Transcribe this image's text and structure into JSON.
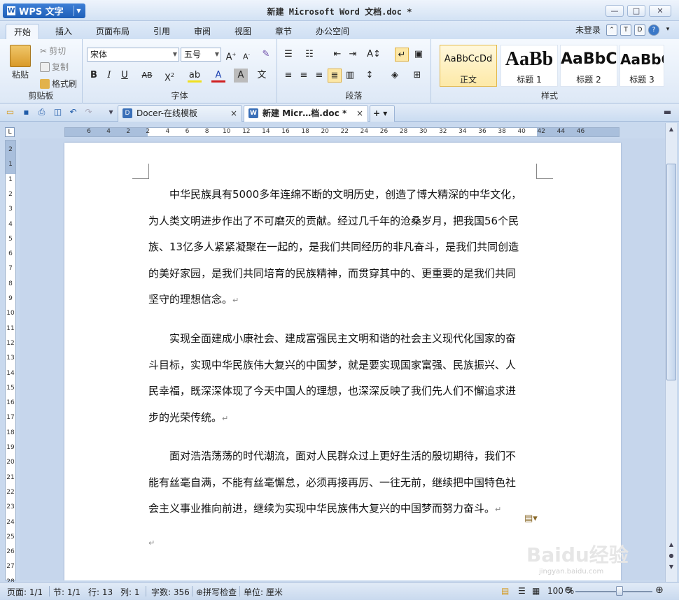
{
  "app": {
    "name": "WPS 文字",
    "title": "新建 Microsoft Word 文档.doc *"
  },
  "window_controls": {
    "minimize": "—",
    "maximize": "□",
    "close": "✕"
  },
  "menu": {
    "tabs": [
      "开始",
      "插入",
      "页面布局",
      "引用",
      "审阅",
      "视图",
      "章节",
      "办公空间"
    ],
    "login": "未登录"
  },
  "ribbon": {
    "clipboard": {
      "paste": "粘贴",
      "cut": "剪切",
      "copy": "复制",
      "format_painter": "格式刷",
      "label": "剪贴板"
    },
    "font": {
      "font_name": "宋体",
      "font_size": "五号",
      "label": "字体"
    },
    "paragraph": {
      "label": "段落"
    },
    "styles": {
      "label": "样式",
      "items": [
        {
          "sample": "AaBbCcDd",
          "name": "正文"
        },
        {
          "sample": "AaBb",
          "name": "标题 1"
        },
        {
          "sample": "AaBbC",
          "name": "标题 2"
        },
        {
          "sample": "AaBbC",
          "name": "标题 3"
        }
      ]
    }
  },
  "doc_tabs": [
    {
      "label": "Docer-在线模板",
      "active": false
    },
    {
      "label": "新建 Micr…档.doc *",
      "active": true
    }
  ],
  "ruler": {
    "horizontal": [
      "6",
      "4",
      "2",
      "2",
      "4",
      "6",
      "8",
      "10",
      "12",
      "14",
      "16",
      "18",
      "20",
      "22",
      "24",
      "26",
      "28",
      "30",
      "32",
      "34",
      "36",
      "38",
      "40",
      "42",
      "44",
      "46"
    ],
    "vertical": [
      "2",
      "1",
      "1",
      "2",
      "3",
      "4",
      "5",
      "6",
      "7",
      "8",
      "9",
      "10",
      "11",
      "12",
      "13",
      "14",
      "15",
      "16",
      "17",
      "18",
      "19",
      "20",
      "21",
      "22",
      "23",
      "24",
      "25",
      "26",
      "27",
      "28"
    ]
  },
  "document": {
    "paragraphs": [
      [
        "中华民族具有5000多年连绵不断的文明历史，创造了博大精深的中华文化，",
        "为人类文明进步作出了不可磨灭的贡献。经过几千年的沧桑岁月，把我国56个民",
        "族、13亿多人紧紧凝聚在一起的，是我们共同经历的非凡奋斗，是我们共同创造",
        "的美好家园，是我们共同培育的民族精神，而贯穿其中的、更重要的是我们共同",
        "坚守的理想信念。"
      ],
      [
        "实现全面建成小康社会、建成富强民主文明和谐的社会主义现代化国家的奋",
        "斗目标，实现中华民族伟大复兴的中国梦，就是要实现国家富强、民族振兴、人",
        "民幸福，既深深体现了今天中国人的理想，也深深反映了我们先人们不懈追求进",
        "步的光荣传统。"
      ],
      [
        "面对浩浩荡荡的时代潮流，面对人民群众过上更好生活的殷切期待，我们不",
        "能有丝毫自满，不能有丝毫懈怠，必须再接再厉、一往无前，继续把中国特色社",
        "会主义事业推向前进，继续为实现中华民族伟大复兴的中国梦而努力奋斗。"
      ]
    ],
    "para_mark": "↵"
  },
  "status": {
    "page": "页面: 1/1",
    "section": "节: 1/1",
    "row": "行: 13",
    "col": "列: 1",
    "words": "字数: 356",
    "spellcheck": "拼写检查",
    "unit": "单位: 厘米",
    "zoom": "100 %"
  },
  "watermark": {
    "text": "Baidu经验",
    "sub": "jingyan.baidu.com"
  },
  "colors": {
    "accent": "#1f5fb8",
    "ribbon_bg": "#dde8f6",
    "workspace_bg": "#c6d6ec"
  }
}
